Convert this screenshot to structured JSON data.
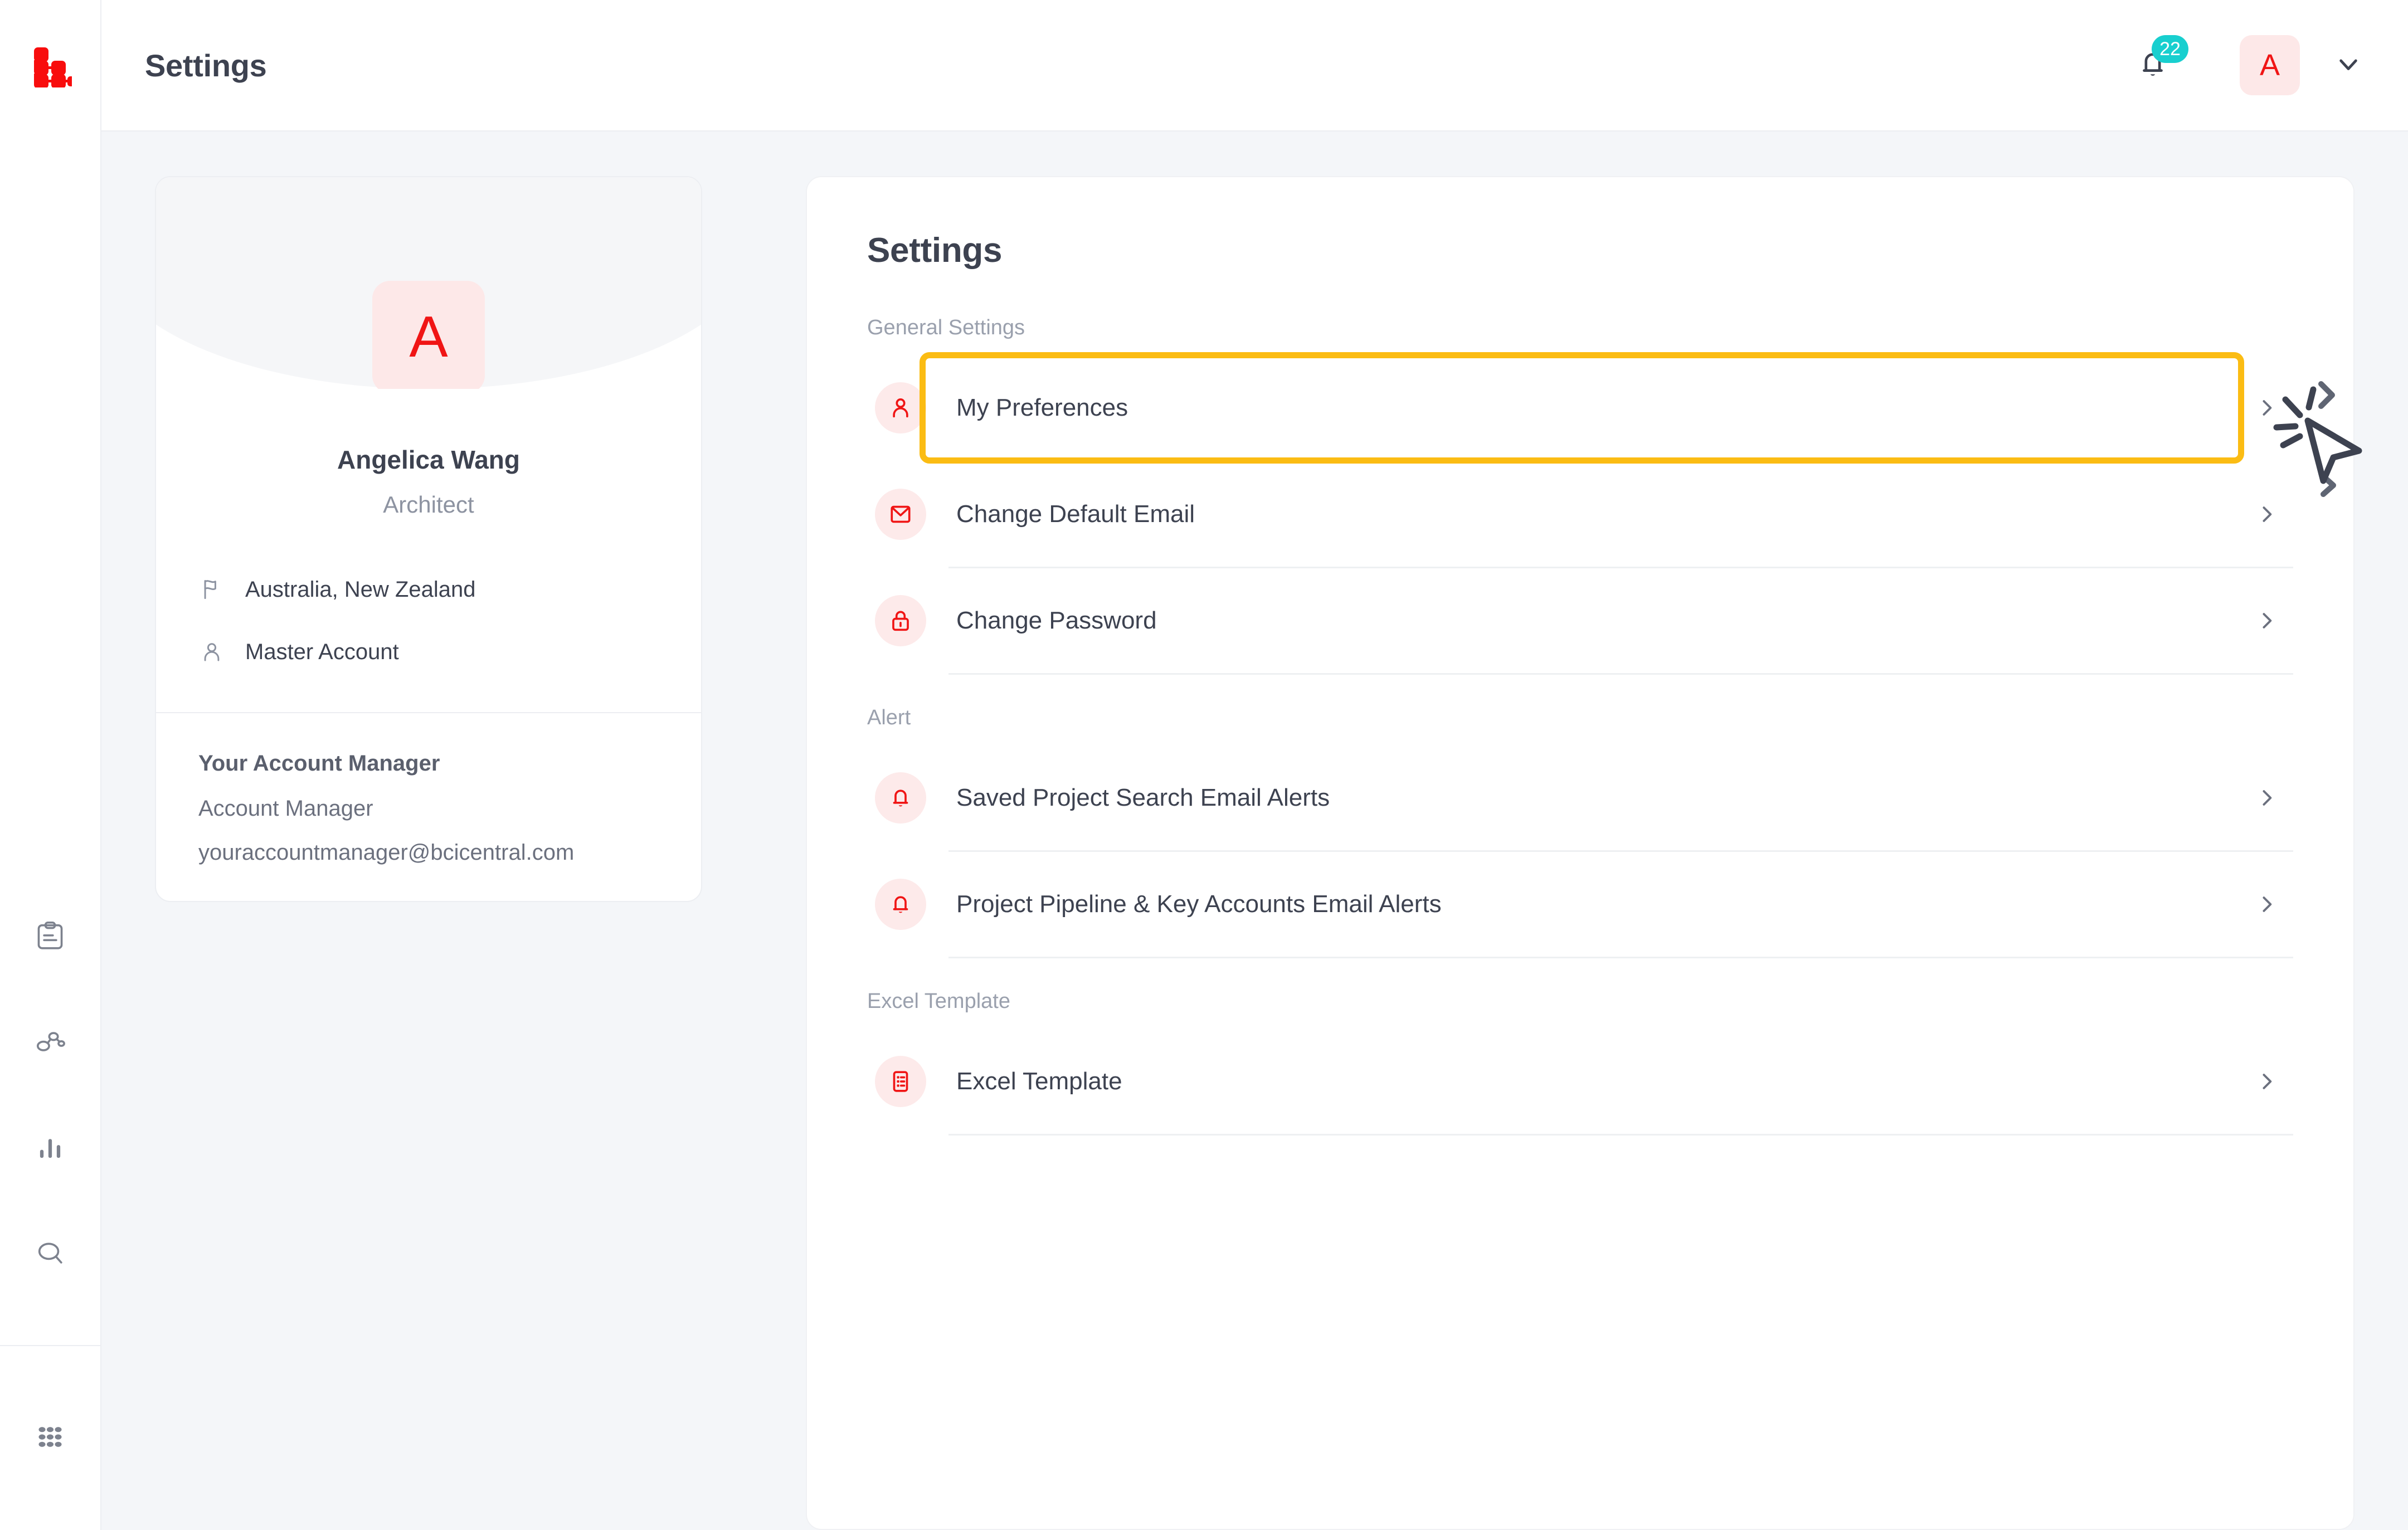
{
  "brand": {
    "logo_name": "bci-central-logo",
    "accent_red": "#f01515",
    "highlight_yellow": "#fbbc13",
    "badge_teal": "#18cfcf"
  },
  "topbar": {
    "title": "Settings",
    "notifications": {
      "icon": "bell-icon",
      "count": "22"
    },
    "avatar_initial": "A",
    "caret_icon": "chevron-down-icon"
  },
  "rail": {
    "items": [
      {
        "icon": "clipboard-icon",
        "name": "sidebar-item-projects"
      },
      {
        "icon": "network-nodes-icon",
        "name": "sidebar-item-companies"
      },
      {
        "icon": "bar-chart-icon",
        "name": "sidebar-item-analytics"
      },
      {
        "icon": "search-icon",
        "name": "sidebar-item-search"
      }
    ],
    "apps": {
      "icon": "grid-dots-icon",
      "name": "sidebar-item-apps"
    }
  },
  "profile": {
    "avatar_initial": "A",
    "name": "Angelica Wang",
    "role": "Architect",
    "meta": [
      {
        "icon": "flag-icon",
        "text": "Australia, New Zealand"
      },
      {
        "icon": "person-icon",
        "text": "Master Account"
      }
    ],
    "account_manager": {
      "title": "Your Account Manager",
      "name": "Account Manager",
      "email": "youraccountmanager@bcicentral.com"
    }
  },
  "settings": {
    "title": "Settings",
    "groups": [
      {
        "label": "General Settings",
        "rows": [
          {
            "icon": "person-icon",
            "label": "My Preferences",
            "highlighted": true
          },
          {
            "icon": "envelope-icon",
            "label": "Change Default Email",
            "highlighted": false
          },
          {
            "icon": "lock-icon",
            "label": "Change Password",
            "highlighted": false
          }
        ]
      },
      {
        "label": "Alert",
        "rows": [
          {
            "icon": "bell-icon",
            "label": "Saved Project Search Email Alerts",
            "highlighted": false
          },
          {
            "icon": "bell-icon",
            "label": "Project Pipeline & Key Accounts Email Alerts",
            "highlighted": false
          }
        ]
      },
      {
        "label": "Excel Template",
        "rows": [
          {
            "icon": "list-document-icon",
            "label": "Excel Template",
            "highlighted": false
          }
        ]
      }
    ],
    "chevron_icon": "chevron-right-icon"
  },
  "cursor": {
    "icon": "click-cursor-icon"
  }
}
